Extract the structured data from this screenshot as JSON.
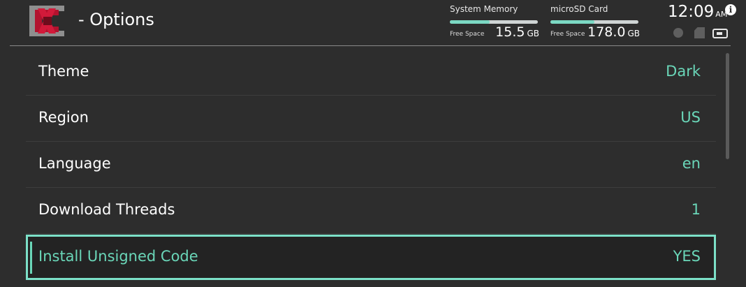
{
  "header": {
    "title": "- Options",
    "logo_icon": "gpx-logo-icon"
  },
  "storage": {
    "system": {
      "label": "System Memory",
      "free_label": "Free Space",
      "free_value": "15.5",
      "unit": "GB",
      "used_fraction": 0.45
    },
    "sd": {
      "label": "microSD Card",
      "free_label": "Free Space",
      "free_value": "178.0",
      "unit": "GB",
      "used_fraction": 0.5
    }
  },
  "clock": {
    "time": "12:09",
    "ampm": "AM",
    "info_glyph": "i"
  },
  "status_icons": [
    "globe-icon",
    "sd-card-icon",
    "battery-icon"
  ],
  "options": [
    {
      "label": "Theme",
      "value": "Dark"
    },
    {
      "label": "Region",
      "value": "US"
    },
    {
      "label": "Language",
      "value": "en"
    },
    {
      "label": "Download Threads",
      "value": "1"
    },
    {
      "label": "Install Unsigned Code",
      "value": "YES",
      "selected": true
    }
  ],
  "colors": {
    "accent": "#6ad6b8",
    "selection_border": "#7ce0c8",
    "background": "#2d2d2d"
  }
}
